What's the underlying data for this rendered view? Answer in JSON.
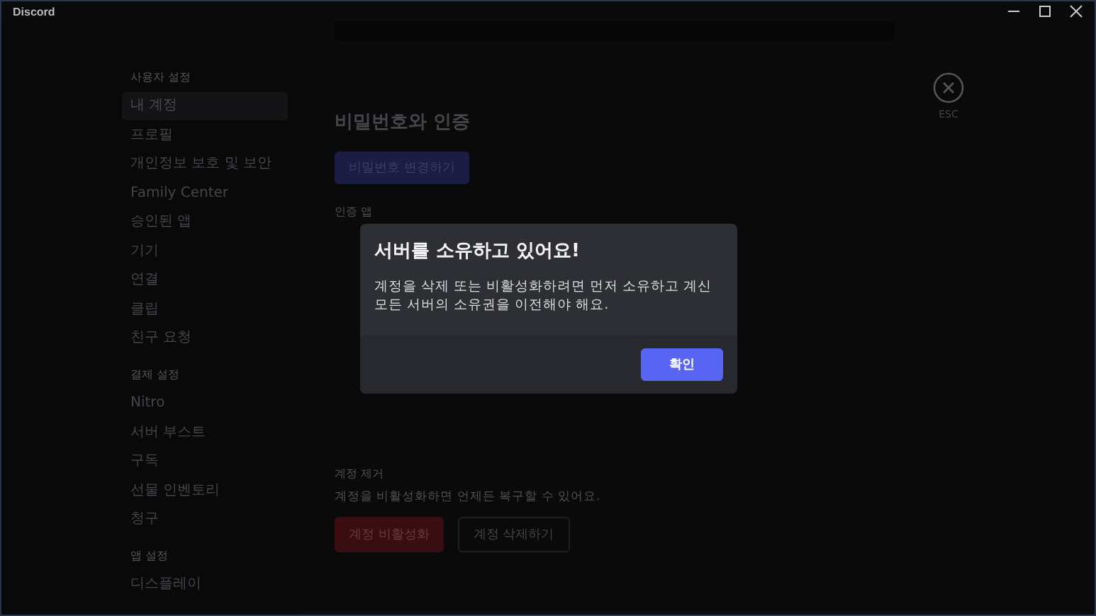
{
  "window": {
    "title": "Discord"
  },
  "sidebar": {
    "sections": [
      {
        "header": "사용자 설정",
        "items": [
          {
            "label": "내 계정",
            "selected": true
          },
          {
            "label": "프로필",
            "selected": false
          },
          {
            "label": "개인정보 보호 및 보안",
            "selected": false
          },
          {
            "label": "Family Center",
            "selected": false
          },
          {
            "label": "승인된 앱",
            "selected": false
          },
          {
            "label": "기기",
            "selected": false
          },
          {
            "label": "연결",
            "selected": false
          },
          {
            "label": "클립",
            "selected": false
          },
          {
            "label": "친구 요청",
            "selected": false
          }
        ]
      },
      {
        "header": "결제 설정",
        "items": [
          {
            "label": "Nitro",
            "selected": false
          },
          {
            "label": "서버 부스트",
            "selected": false
          },
          {
            "label": "구독",
            "selected": false
          },
          {
            "label": "선물 인벤토리",
            "selected": false
          },
          {
            "label": "청구",
            "selected": false
          }
        ]
      },
      {
        "header": "앱 설정",
        "items": [
          {
            "label": "디스플레이",
            "selected": false
          }
        ]
      }
    ]
  },
  "main": {
    "section_title": "비밀번호와 인증",
    "change_password_button": "비밀번호 변경하기",
    "auth_app_label": "인증 앱",
    "account_removal": {
      "label": "계정 제거",
      "description": "계정을 비활성화하면 언제든 복구할 수 있어요.",
      "buttons": [
        {
          "label": "계정 비활성화",
          "kind": "danger"
        },
        {
          "label": "계정 삭제하기",
          "kind": "outline"
        }
      ]
    },
    "close_hint": "ESC"
  },
  "dialog": {
    "title": "서버를 소유하고 있어요!",
    "body": "계정을 삭제 또는 비활성화하려면 먼저 소유하고 계신 모든 서버의 소유권을 이전해야 해요.",
    "confirm_button": "확인"
  }
}
